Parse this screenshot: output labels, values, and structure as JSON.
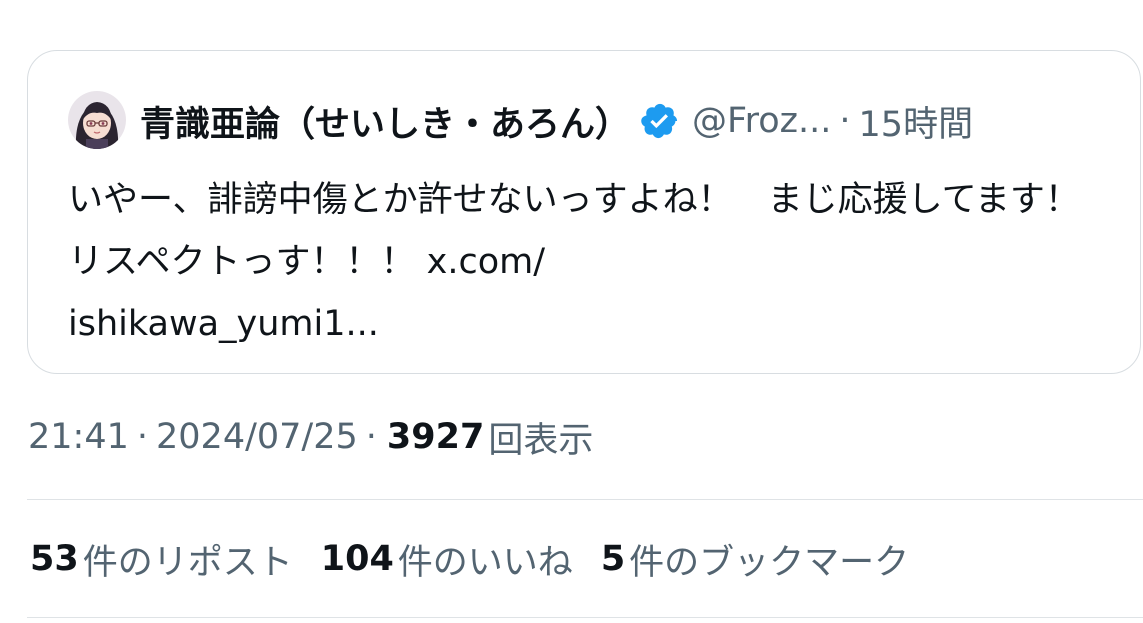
{
  "quote": {
    "display_name": "青識亜論（せいしき・あろん）",
    "handle": "@Froz...",
    "separator": "·",
    "time_ago": "15時間",
    "text": "いやー、誹謗中傷とか許せないっすよね！　まじ応援してます！　リスペクトっす！！！ x.com/\nishikawa_yumi1...",
    "verified_icon": "verified-badge",
    "verified_color": "#1d9bf0"
  },
  "meta": {
    "time": "21:41",
    "separator": "·",
    "date": "2024/07/25",
    "views_count": "3927",
    "views_label": "回表示"
  },
  "stats": {
    "reposts_count": "53",
    "reposts_label": "件のリポスト",
    "likes_count": "104",
    "likes_label": "件のいいね",
    "bookmarks_count": "5",
    "bookmarks_label": "件のブックマーク"
  },
  "colors": {
    "text_primary": "#0f1419",
    "text_secondary": "#536471",
    "border": "#d8dde1"
  }
}
